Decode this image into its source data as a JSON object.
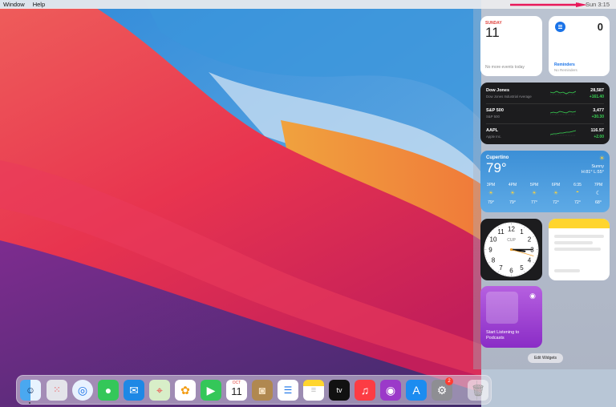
{
  "menubar": {
    "items": [
      "Window",
      "Help"
    ],
    "clock": "Sun 3:15"
  },
  "widgets": {
    "calendar": {
      "day_label": "SUNDAY",
      "date": "11",
      "no_events": "No more events today"
    },
    "reminders": {
      "count": "0",
      "title": "Reminders",
      "subtitle": "No Reminders"
    },
    "stocks": [
      {
        "symbol": "Dow Jones",
        "name": "Dow Jones Industrial Average",
        "price": "28,587",
        "change": "+161.40"
      },
      {
        "symbol": "S&P 500",
        "name": "S&P 500",
        "price": "3,477",
        "change": "+30.30"
      },
      {
        "symbol": "AAPL",
        "name": "Apple Inc.",
        "price": "116.97",
        "change": "+2.00"
      }
    ],
    "weather": {
      "city": "Cupertino",
      "temp": "79°",
      "condition": "Sunny",
      "hilo": "H:81° L:55°",
      "hours": [
        {
          "time": "3PM",
          "icon": "sun-icon",
          "temp": "79°"
        },
        {
          "time": "4PM",
          "icon": "sun-icon",
          "temp": "79°"
        },
        {
          "time": "5PM",
          "icon": "sun-icon",
          "temp": "77°"
        },
        {
          "time": "6PM",
          "icon": "sun-icon",
          "temp": "72°"
        },
        {
          "time": "6:35",
          "icon": "sunset-icon",
          "temp": "72°"
        },
        {
          "time": "7PM",
          "icon": "moon-icon",
          "temp": "68°"
        }
      ]
    },
    "clock": {
      "label": "CUP",
      "numbers": [
        "12",
        "1",
        "2",
        "3",
        "4",
        "5",
        "6",
        "7",
        "8",
        "9",
        "10",
        "11"
      ],
      "hour": 3,
      "minute": 15
    },
    "podcasts": {
      "text": "Start Listening to Podcasts"
    },
    "edit_button": "Edit Widgets"
  },
  "dock": {
    "apps": [
      "finder",
      "launchpad",
      "safari",
      "messages",
      "mail",
      "maps",
      "photos",
      "facetime",
      "calendar",
      "contacts",
      "reminders",
      "notes",
      "tv",
      "music",
      "podcasts",
      "app-store",
      "system-preferences"
    ],
    "calendar_month": "OCT",
    "calendar_day": "11",
    "tv_label": "tv",
    "settings_badge": "2"
  },
  "colors": {
    "accent_red": "#e0443e",
    "stock_green": "#39d353",
    "reminders_blue": "#1a73e8"
  }
}
